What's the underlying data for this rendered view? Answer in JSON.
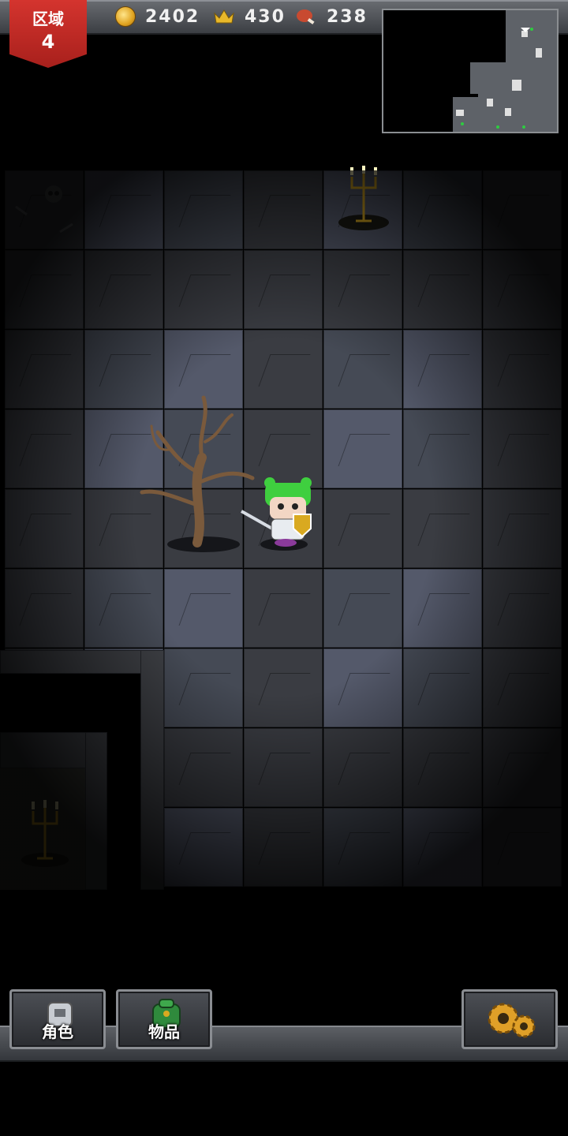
{
  "hud": {
    "zone_label": "区域",
    "zone_number": "4",
    "coins": "2402",
    "crowns": "430",
    "food": "238",
    "icons": [
      "coin-icon",
      "crown-icon",
      "meat-icon"
    ]
  },
  "buttons": {
    "character_label": "角色",
    "items_label": "物品",
    "settings_icon": "gears-icon"
  },
  "colors": {
    "zone_badge": "#c8302a",
    "hero_hair": "#3fcf3f",
    "candle_gold": "#d9a920"
  }
}
